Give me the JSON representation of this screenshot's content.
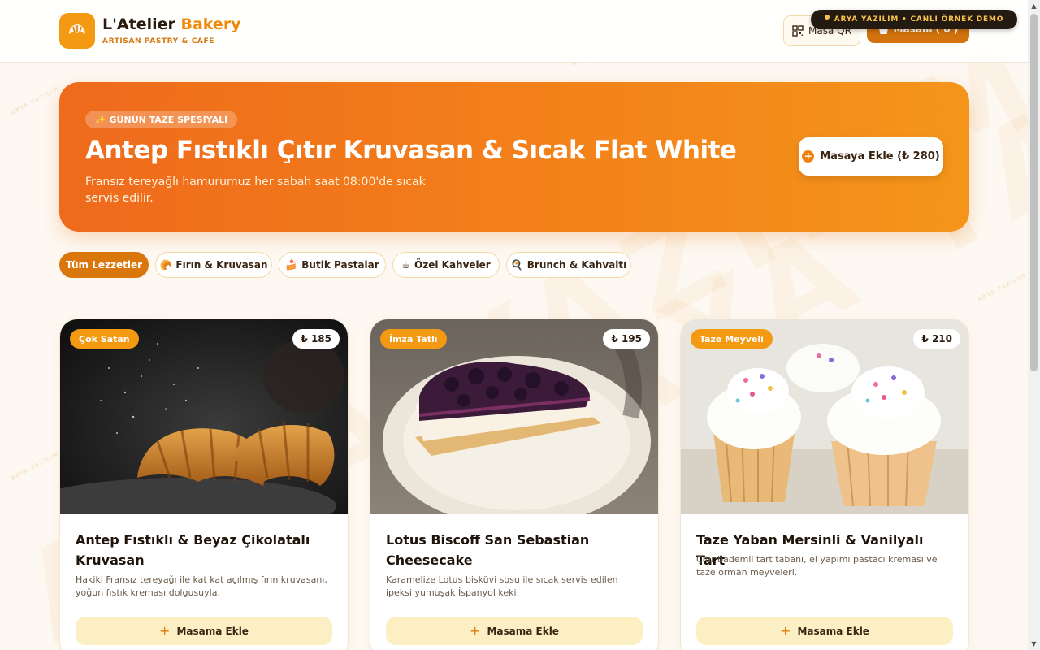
{
  "brand": {
    "name_part1": "L'Atelier ",
    "name_part2": "Bakery",
    "subtitle": "ARTISAN PASTRY & CAFE",
    "logo_icon": "croissant-icon"
  },
  "header": {
    "qr_label": "Masa QR",
    "cart_label": "Masam ( 0 )",
    "demo_badge": "ARYA YAZILIM • CANLI ÖRNEK DEMO"
  },
  "hero": {
    "pill": "✨ GÜNÜN TAZE SPESİYALİ",
    "title": "Antep Fıstıklı Çıtır Kruvasan & Sıcak Flat White",
    "description": "Fransız tereyağlı hamurumuz her sabah saat 08:00'de sıcak servis edilir.",
    "button_label": "Masaya Ekle (₺ 280)"
  },
  "categories": [
    {
      "label": "Tüm Lezzetler",
      "icon": "",
      "active": true
    },
    {
      "label": "Fırın & Kruvasan",
      "icon": "🥐",
      "active": false
    },
    {
      "label": "Butik Pastalar",
      "icon": "🍰",
      "active": false
    },
    {
      "label": "Özel Kahveler",
      "icon": "☕",
      "active": false
    },
    {
      "label": "Brunch & Kahvaltı",
      "icon": "🍳",
      "active": false
    }
  ],
  "products": [
    {
      "badge": "Çok Satan",
      "price": "₺ 185",
      "title": "Antep Fıstıklı & Beyaz Çikolatalı Kruvasan",
      "description": "Hakiki Fransız tereyağı ile kat kat açılmış fırın kruvasanı, yoğun fıstık kreması dolgusuyla.",
      "button_label": "Masama Ekle"
    },
    {
      "badge": "İmza Tatlı",
      "price": "₺ 195",
      "title": "Lotus Biscoff San Sebastian Cheesecake",
      "description": "Karamelize Lotus bisküvi sosu ile sıcak servis edilen ipeksi yumuşak İspanyol keki.",
      "button_label": "Masama Ekle"
    },
    {
      "badge": "Taze Meyveli",
      "price": "₺ 210",
      "title": "Taze Yaban Mersinli & Vanilyalı Tart",
      "description": "Çıtır bademli tart tabanı, el yapımı pastacı kreması ve taze orman meyveleri.",
      "button_label": "Masama Ekle"
    }
  ],
  "watermark": "ARYA YAZILIM",
  "colors": {
    "accent": "#f08a0a",
    "accent_dark": "#d9760c",
    "hero_start": "#ee6a1c",
    "hero_end": "#f4951a",
    "button_soft": "#fdefc4"
  }
}
